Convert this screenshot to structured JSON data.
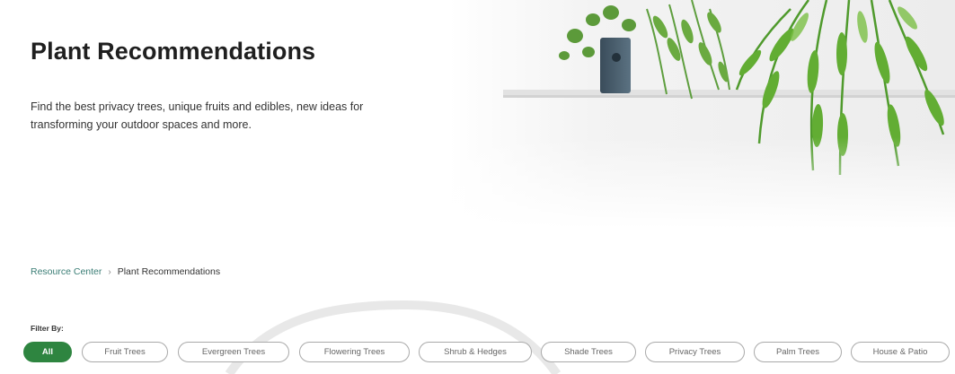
{
  "hero": {
    "title": "Plant Recommendations",
    "description": "Find the best privacy trees, unique fruits and edibles, new ideas for transforming your outdoor spaces and more."
  },
  "breadcrumb": {
    "items": [
      "Resource Center",
      "Plant Recommendations"
    ],
    "separator": "›"
  },
  "filter": {
    "label": "Filter By:",
    "selected": "All",
    "chips": [
      "All",
      "Fruit Trees",
      "Evergreen Trees",
      "Flowering Trees",
      "Shrub & Hedges",
      "Shade Trees",
      "Privacy Trees",
      "Palm Trees",
      "House & Patio"
    ]
  },
  "colors": {
    "accent": "#2e8540",
    "link": "#3a7d75"
  }
}
